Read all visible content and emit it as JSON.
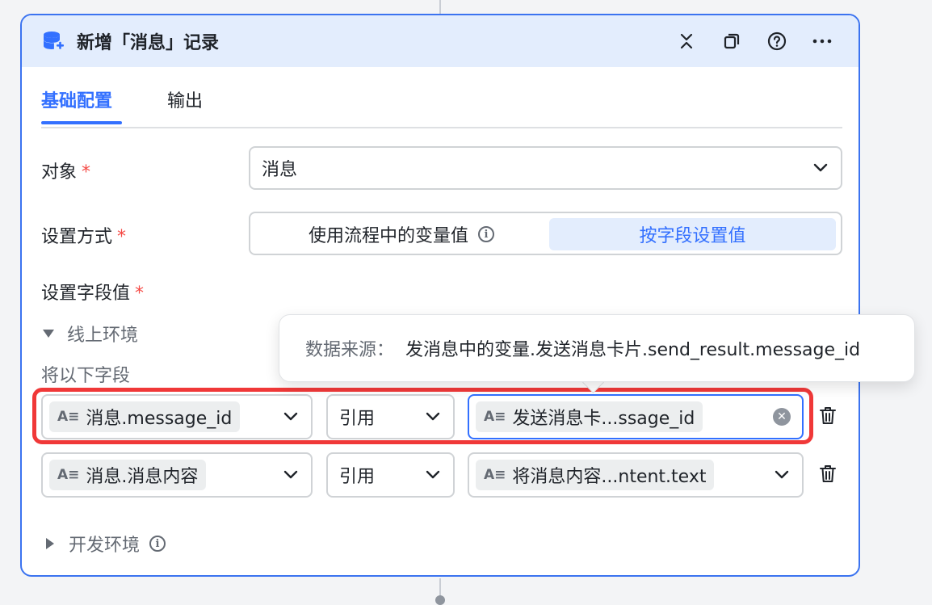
{
  "header": {
    "title": "新增「消息」记录",
    "icons": [
      "database-add-icon",
      "collapse-icon",
      "copy-icon",
      "help-icon",
      "more-icon"
    ],
    "accent": "#3370ff"
  },
  "tabs": [
    {
      "label": "基础配置",
      "active": true
    },
    {
      "label": "输出",
      "active": false
    }
  ],
  "form": {
    "object_label": "对象",
    "object_value": "消息",
    "mode_label": "设置方式",
    "mode_options": [
      "使用流程中的变量值",
      "按字段设置值"
    ],
    "mode_selected": "按字段设置值",
    "fields_label": "设置字段值",
    "required_mark": "*"
  },
  "env_online": {
    "label": "线上环境",
    "sub_label": "将以下字段",
    "rows": [
      {
        "field": "消息.message_id",
        "op": "引用",
        "value": "发送消息卡...ssage_id",
        "clearable": true
      },
      {
        "field": "消息.消息内容",
        "op": "引用",
        "value": "将消息内容...ntent.text",
        "clearable": false
      }
    ]
  },
  "env_dev": {
    "label": "开发环境"
  },
  "tooltip": {
    "label": "数据来源：",
    "value": "发消息中的变量.发送消息卡片.send_result.message_id"
  },
  "highlight_color": "#f03838",
  "tag_icon_text": "A≡"
}
